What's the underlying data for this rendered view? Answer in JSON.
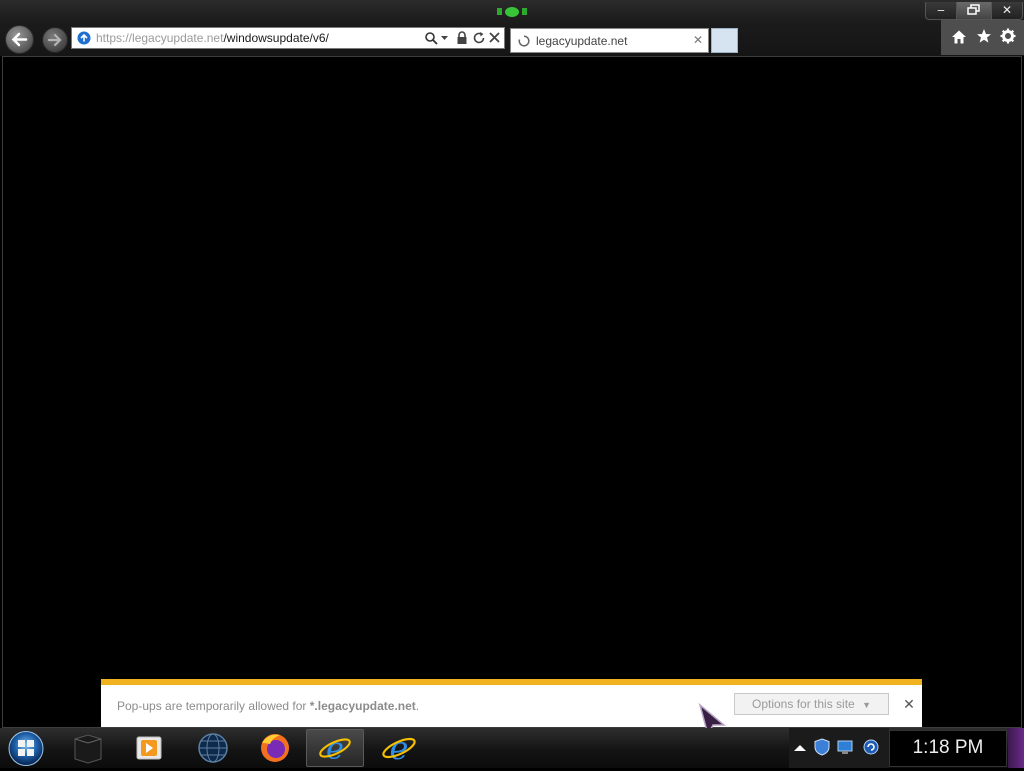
{
  "window": {
    "minimize_glyph": "‒",
    "close_glyph": "✕"
  },
  "address_bar": {
    "url_scheme": "https://",
    "url_domain": "legacyupdate.net",
    "url_path": "/windowsupdate/v6/",
    "search_icon": "search-icon",
    "lock_icon": "lock-icon"
  },
  "tab": {
    "title": "legacyupdate.net",
    "close_glyph": "✕"
  },
  "toolbar": {
    "icons": [
      "home-icon",
      "favorites-star-icon",
      "tools-gear-icon"
    ]
  },
  "notification": {
    "message_prefix": "Pop-ups are temporarily allowed for ",
    "site": "*.legacyupdate.net",
    "message_suffix": ".",
    "options_label": "Options for this site",
    "close_glyph": "✕",
    "accent_color": "#f0b21f"
  },
  "taskbar": {
    "items": [
      {
        "name": "black-app",
        "active": false
      },
      {
        "name": "media-player",
        "active": false
      },
      {
        "name": "globe-app",
        "active": false
      },
      {
        "name": "firefox",
        "active": false
      },
      {
        "name": "internet-explorer",
        "active": true
      },
      {
        "name": "internet-explorer-2",
        "active": false
      }
    ],
    "tray_icons": [
      "show-hidden-icon",
      "security-shield-icon",
      "network-icon",
      "update-icon"
    ],
    "clock": "1:18 PM"
  }
}
